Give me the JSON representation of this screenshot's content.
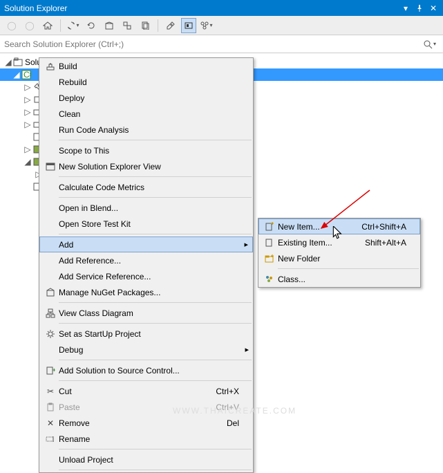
{
  "titlebar": {
    "title": "Solution Explorer"
  },
  "search": {
    "placeholder": "Search Solution Explorer (Ctrl+;)"
  },
  "tree": {
    "root_label": "Solu",
    "root_chev": "◢"
  },
  "menu": {
    "build": "Build",
    "rebuild": "Rebuild",
    "deploy": "Deploy",
    "clean": "Clean",
    "run_code": "Run Code Analysis",
    "scope": "Scope to This",
    "new_sol_exp": "New Solution Explorer View",
    "calc_metrics": "Calculate Code Metrics",
    "open_blend": "Open in Blend...",
    "open_store": "Open Store Test Kit",
    "add": "Add",
    "add_ref": "Add Reference...",
    "add_svc": "Add Service Reference...",
    "nuget": "Manage NuGet Packages...",
    "view_class": "View Class Diagram",
    "startup": "Set as StartUp Project",
    "debug": "Debug",
    "add_src": "Add Solution to Source Control...",
    "cut": "Cut",
    "cut_k": "Ctrl+X",
    "paste": "Paste",
    "paste_k": "Ctrl+V",
    "remove": "Remove",
    "remove_k": "Del",
    "rename": "Rename",
    "unload": "Unload Project"
  },
  "submenu": {
    "new_item": "New Item...",
    "new_item_k": "Ctrl+Shift+A",
    "existing": "Existing Item...",
    "existing_k": "Shift+Alt+A",
    "new_folder": "New Folder",
    "class": "Class..."
  },
  "watermark": "WWW.THAICREATE.COM"
}
